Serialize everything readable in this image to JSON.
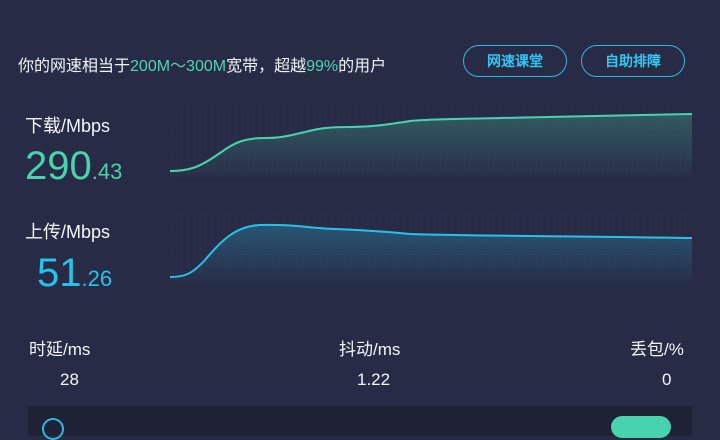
{
  "summary": {
    "prefix": "你的网速相当于",
    "range": "200M～300M",
    "middle": "宽带，超越",
    "percent": "99%",
    "suffix": "的用户"
  },
  "buttons": {
    "course": "网速课堂",
    "diagnose": "自助排障"
  },
  "download": {
    "label": "下载/Mbps",
    "int": "290",
    "dec": ".43",
    "color": "#47d3ad"
  },
  "upload": {
    "label": "上传/Mbps",
    "int": "51",
    "dec": ".26",
    "color": "#27c2ea"
  },
  "stats": {
    "latency_label": "时延/ms",
    "latency_value": "28",
    "jitter_label": "抖动/ms",
    "jitter_value": "1.22",
    "loss_label": "丢包/%",
    "loss_value": "0"
  }
}
